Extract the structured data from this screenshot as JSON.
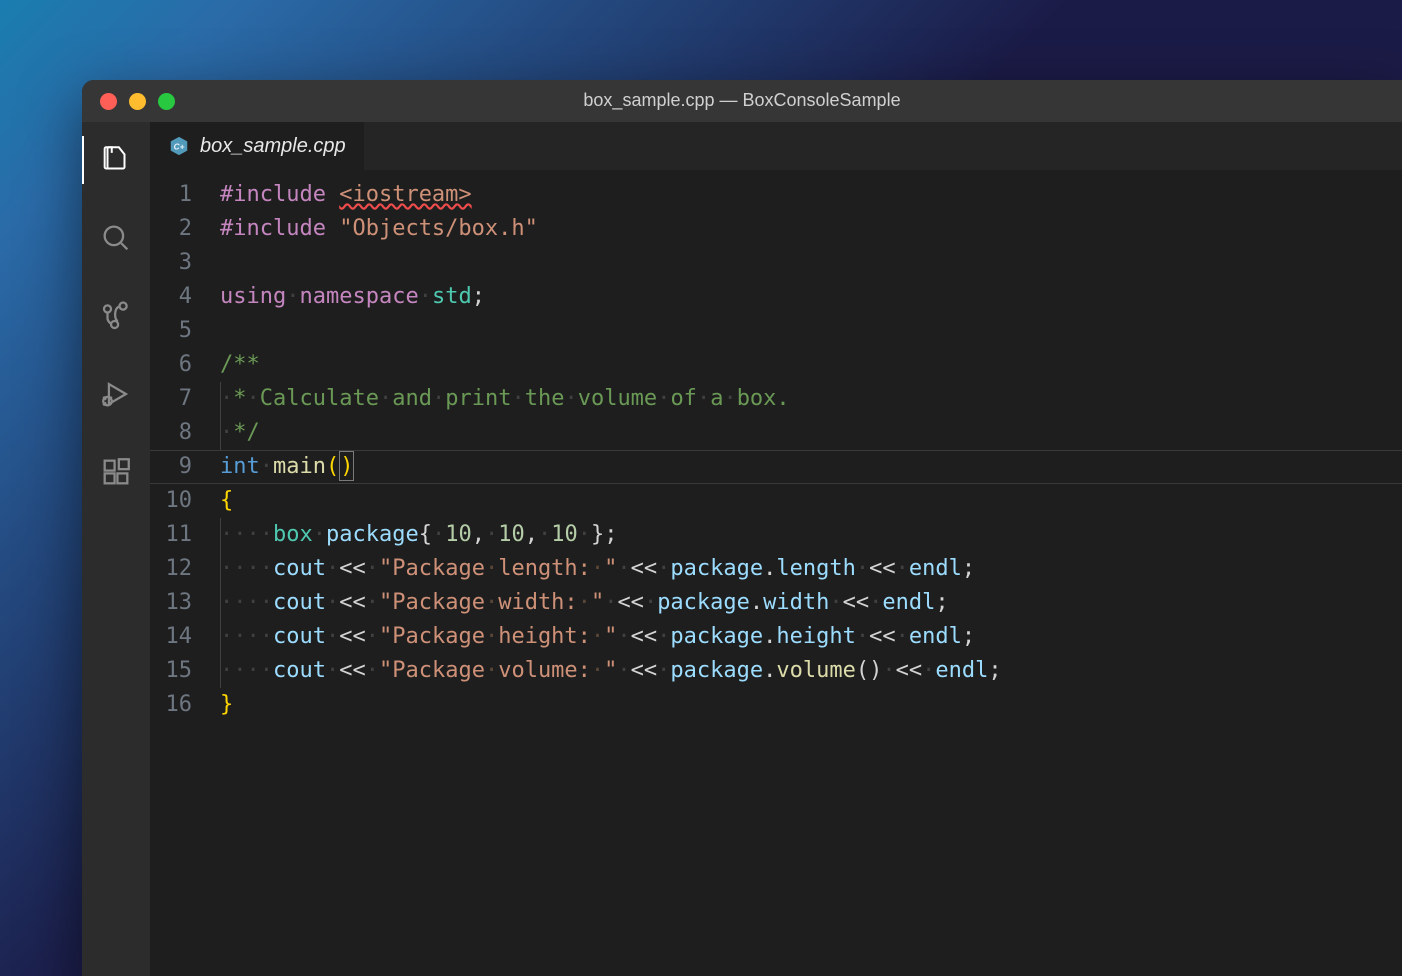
{
  "window": {
    "title": "box_sample.cpp — BoxConsoleSample"
  },
  "activitybar": {
    "items": [
      {
        "name": "explorer"
      },
      {
        "name": "search"
      },
      {
        "name": "scm"
      },
      {
        "name": "run-debug"
      },
      {
        "name": "extensions"
      }
    ]
  },
  "tab": {
    "filename": "box_sample.cpp",
    "language_icon": "cpp"
  },
  "editor": {
    "line_count": 16,
    "current_line": 9,
    "lines": {
      "1": {
        "tokens": [
          [
            "kw",
            "#include"
          ],
          [
            "punc",
            " "
          ],
          [
            "hdr",
            "<iostream>"
          ]
        ]
      },
      "2": {
        "tokens": [
          [
            "kw",
            "#include"
          ],
          [
            "punc",
            " "
          ],
          [
            "str",
            "\"Objects/box.h\""
          ]
        ]
      },
      "3": {
        "tokens": []
      },
      "4": {
        "tokens": [
          [
            "kw",
            "using"
          ],
          [
            "ws",
            "·"
          ],
          [
            "kw",
            "namespace"
          ],
          [
            "ws",
            "·"
          ],
          [
            "ns",
            "std"
          ],
          [
            "punc",
            ";"
          ]
        ]
      },
      "5": {
        "tokens": []
      },
      "6": {
        "tokens": [
          [
            "com",
            "/**"
          ]
        ]
      },
      "7": {
        "tokens": [
          [
            "guide",
            ""
          ],
          [
            "com",
            "·*·Calculate·and·print·the·volume·of·a·box."
          ]
        ]
      },
      "8": {
        "tokens": [
          [
            "guide",
            ""
          ],
          [
            "com",
            "·*/"
          ]
        ]
      },
      "9": {
        "tokens": [
          [
            "type",
            "int"
          ],
          [
            "ws",
            "·"
          ],
          [
            "fn",
            "main"
          ],
          [
            "brk",
            "("
          ],
          [
            "brk-cursor",
            ")"
          ]
        ]
      },
      "10": {
        "tokens": [
          [
            "brk",
            "{"
          ]
        ]
      },
      "11": {
        "indent": 1,
        "tokens": [
          [
            "cls",
            "box"
          ],
          [
            "ws",
            "·"
          ],
          [
            "var",
            "package"
          ],
          [
            "punc",
            "{"
          ],
          [
            "ws",
            "·"
          ],
          [
            "num",
            "10"
          ],
          [
            "punc",
            ","
          ],
          [
            "ws",
            "·"
          ],
          [
            "num",
            "10"
          ],
          [
            "punc",
            ","
          ],
          [
            "ws",
            "·"
          ],
          [
            "num",
            "10"
          ],
          [
            "ws",
            "·"
          ],
          [
            "punc",
            "};"
          ]
        ]
      },
      "12": {
        "indent": 1,
        "tokens": [
          [
            "var",
            "cout"
          ],
          [
            "ws",
            "·"
          ],
          [
            "punc",
            "<<"
          ],
          [
            "ws",
            "·"
          ],
          [
            "str",
            "\"Package·length:·\""
          ],
          [
            "ws",
            "·"
          ],
          [
            "punc",
            "<<"
          ],
          [
            "ws",
            "·"
          ],
          [
            "var",
            "package"
          ],
          [
            "punc",
            "."
          ],
          [
            "var",
            "length"
          ],
          [
            "ws",
            "·"
          ],
          [
            "punc",
            "<<"
          ],
          [
            "ws",
            "·"
          ],
          [
            "var",
            "endl"
          ],
          [
            "punc",
            ";"
          ]
        ]
      },
      "13": {
        "indent": 1,
        "tokens": [
          [
            "var",
            "cout"
          ],
          [
            "ws",
            "·"
          ],
          [
            "punc",
            "<<"
          ],
          [
            "ws",
            "·"
          ],
          [
            "str",
            "\"Package·width:·\""
          ],
          [
            "ws",
            "·"
          ],
          [
            "punc",
            "<<"
          ],
          [
            "ws",
            "·"
          ],
          [
            "var",
            "package"
          ],
          [
            "punc",
            "."
          ],
          [
            "var",
            "width"
          ],
          [
            "ws",
            "·"
          ],
          [
            "punc",
            "<<"
          ],
          [
            "ws",
            "·"
          ],
          [
            "var",
            "endl"
          ],
          [
            "punc",
            ";"
          ]
        ]
      },
      "14": {
        "indent": 1,
        "tokens": [
          [
            "var",
            "cout"
          ],
          [
            "ws",
            "·"
          ],
          [
            "punc",
            "<<"
          ],
          [
            "ws",
            "·"
          ],
          [
            "str",
            "\"Package·height:·\""
          ],
          [
            "ws",
            "·"
          ],
          [
            "punc",
            "<<"
          ],
          [
            "ws",
            "·"
          ],
          [
            "var",
            "package"
          ],
          [
            "punc",
            "."
          ],
          [
            "var",
            "height"
          ],
          [
            "ws",
            "·"
          ],
          [
            "punc",
            "<<"
          ],
          [
            "ws",
            "·"
          ],
          [
            "var",
            "endl"
          ],
          [
            "punc",
            ";"
          ]
        ]
      },
      "15": {
        "indent": 1,
        "tokens": [
          [
            "var",
            "cout"
          ],
          [
            "ws",
            "·"
          ],
          [
            "punc",
            "<<"
          ],
          [
            "ws",
            "·"
          ],
          [
            "str",
            "\"Package·volume:·\""
          ],
          [
            "ws",
            "·"
          ],
          [
            "punc",
            "<<"
          ],
          [
            "ws",
            "·"
          ],
          [
            "var",
            "package"
          ],
          [
            "punc",
            "."
          ],
          [
            "fn",
            "volume"
          ],
          [
            "punc",
            "()"
          ],
          [
            "ws",
            "·"
          ],
          [
            "punc",
            "<<"
          ],
          [
            "ws",
            "·"
          ],
          [
            "var",
            "endl"
          ],
          [
            "punc",
            ";"
          ]
        ]
      },
      "16": {
        "tokens": [
          [
            "brk",
            "}"
          ]
        ]
      }
    }
  }
}
